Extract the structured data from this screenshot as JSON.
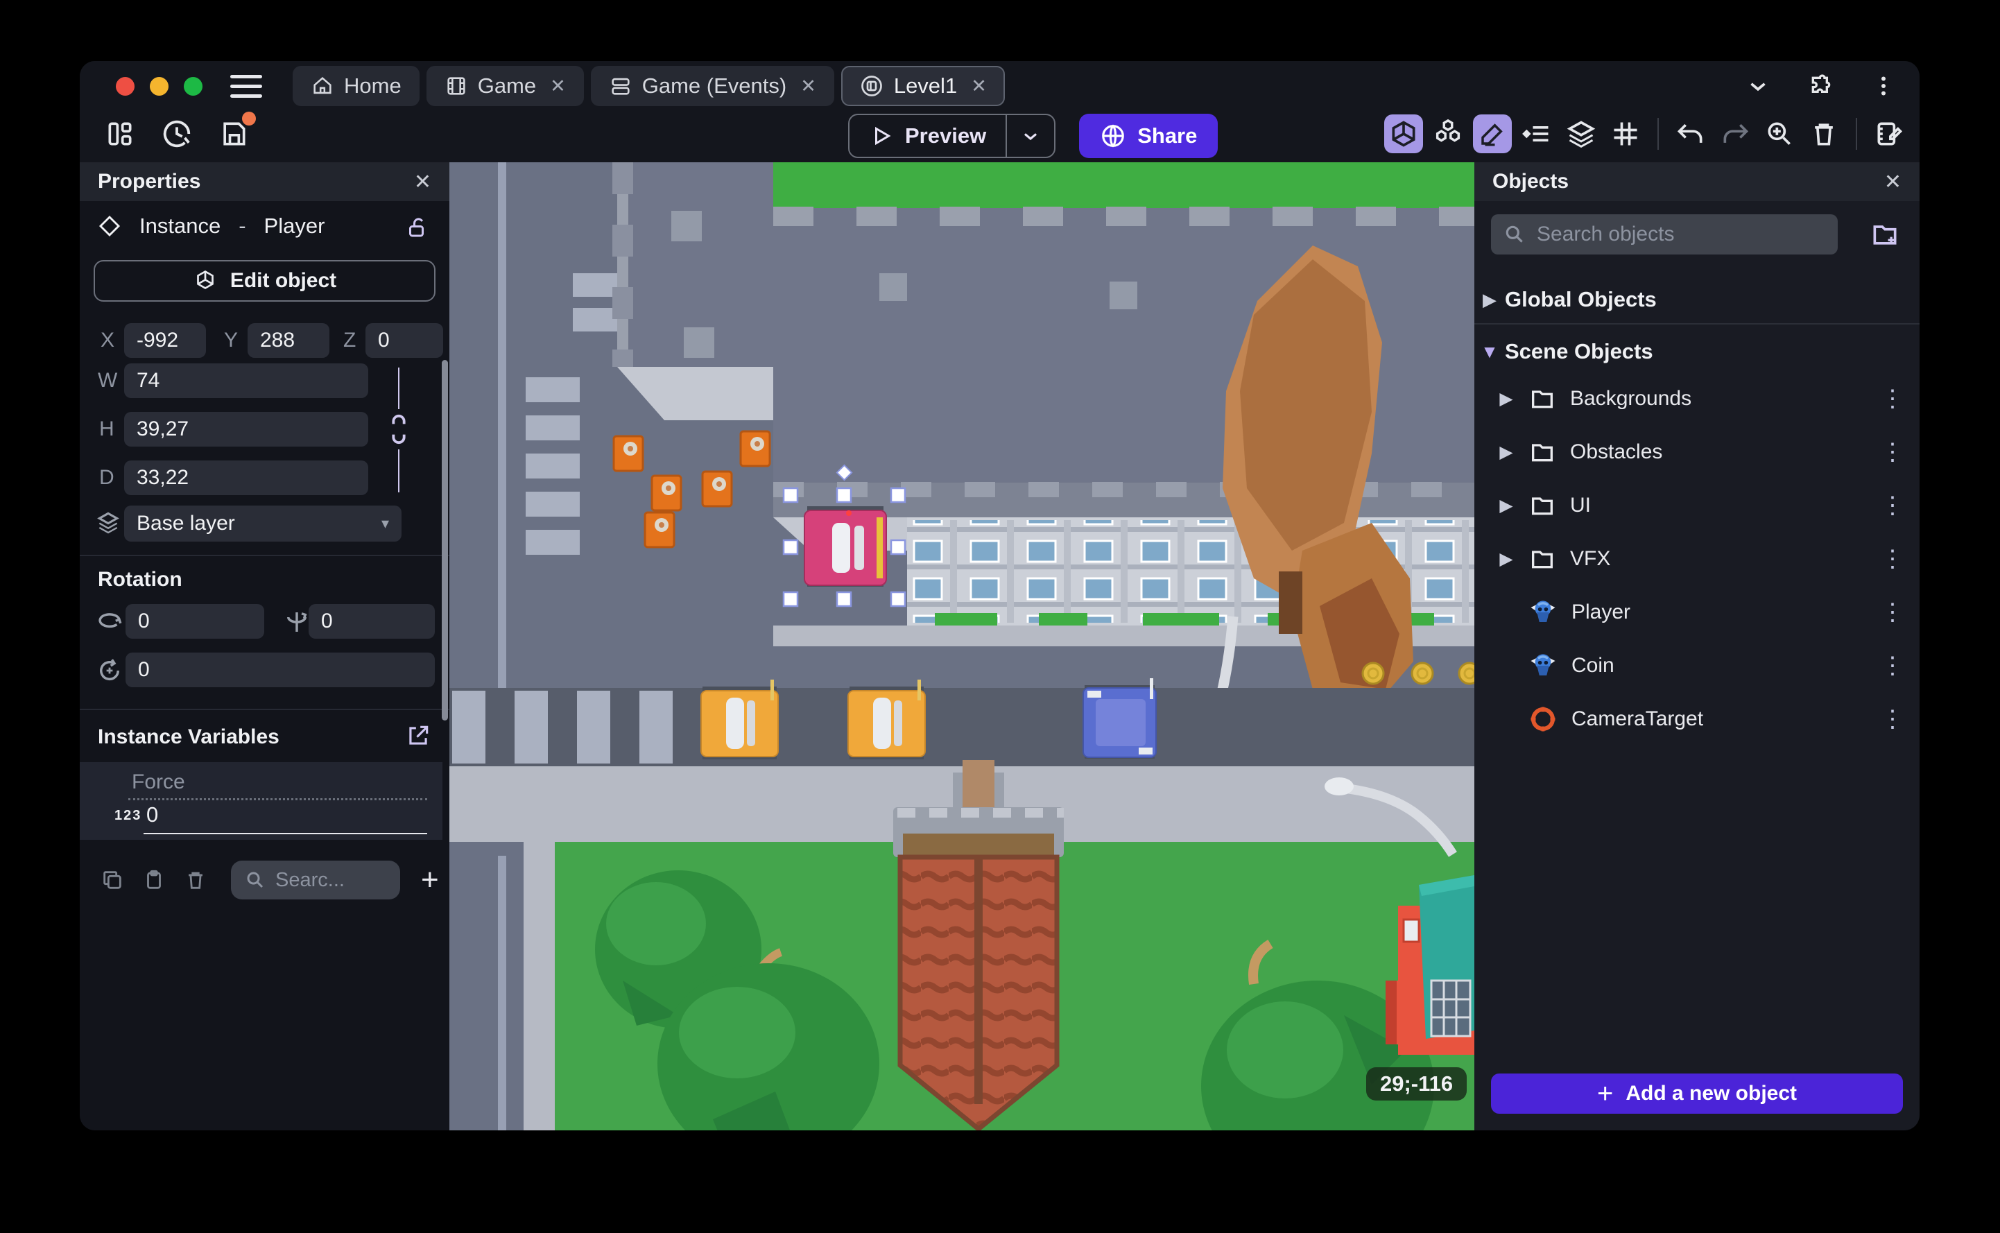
{
  "colors": {
    "accent": "#4b24d8",
    "toggle_active": "#a598e6",
    "unsaved_dot": "#f0764a",
    "light_red": "#ee4f43",
    "light_yellow": "#f5b52e",
    "light_green": "#1db945"
  },
  "tabbar": {
    "tabs": [
      {
        "label": "Home"
      },
      {
        "label": "Game"
      },
      {
        "label": "Game (Events)"
      },
      {
        "label": "Level1"
      }
    ]
  },
  "toolbar": {
    "preview_label": "Preview",
    "share_label": "Share"
  },
  "properties": {
    "title": "Properties",
    "instance_type": "Instance",
    "separator": "-",
    "instance_name": "Player",
    "edit_object_label": "Edit object",
    "coords": {
      "x_label": "X",
      "x": "-992",
      "y_label": "Y",
      "y": "288",
      "z_label": "Z",
      "z": "0"
    },
    "size": {
      "w_label": "W",
      "w": "74",
      "h_label": "H",
      "h": "39,27",
      "d_label": "D",
      "d": "33,22"
    },
    "layer": "Base layer",
    "rotation_title": "Rotation",
    "rotation": {
      "x": "0",
      "y": "0",
      "z": "0"
    },
    "variables_title": "Instance Variables",
    "variable": {
      "name": "Force",
      "type_badge": "123",
      "value": "0"
    },
    "variables_search_placeholder": "Searc..."
  },
  "objects_panel": {
    "title": "Objects",
    "search_placeholder": "Search objects",
    "global_group": "Global Objects",
    "scene_group": "Scene Objects",
    "items": [
      {
        "label": "Backgrounds",
        "kind": "folder"
      },
      {
        "label": "Obstacles",
        "kind": "folder"
      },
      {
        "label": "UI",
        "kind": "folder"
      },
      {
        "label": "VFX",
        "kind": "folder"
      },
      {
        "label": "Player",
        "kind": "object"
      },
      {
        "label": "Coin",
        "kind": "object"
      },
      {
        "label": "CameraTarget",
        "kind": "target"
      }
    ],
    "add_button": "Add a new object"
  },
  "canvas": {
    "coords_badge": "29;-116"
  }
}
